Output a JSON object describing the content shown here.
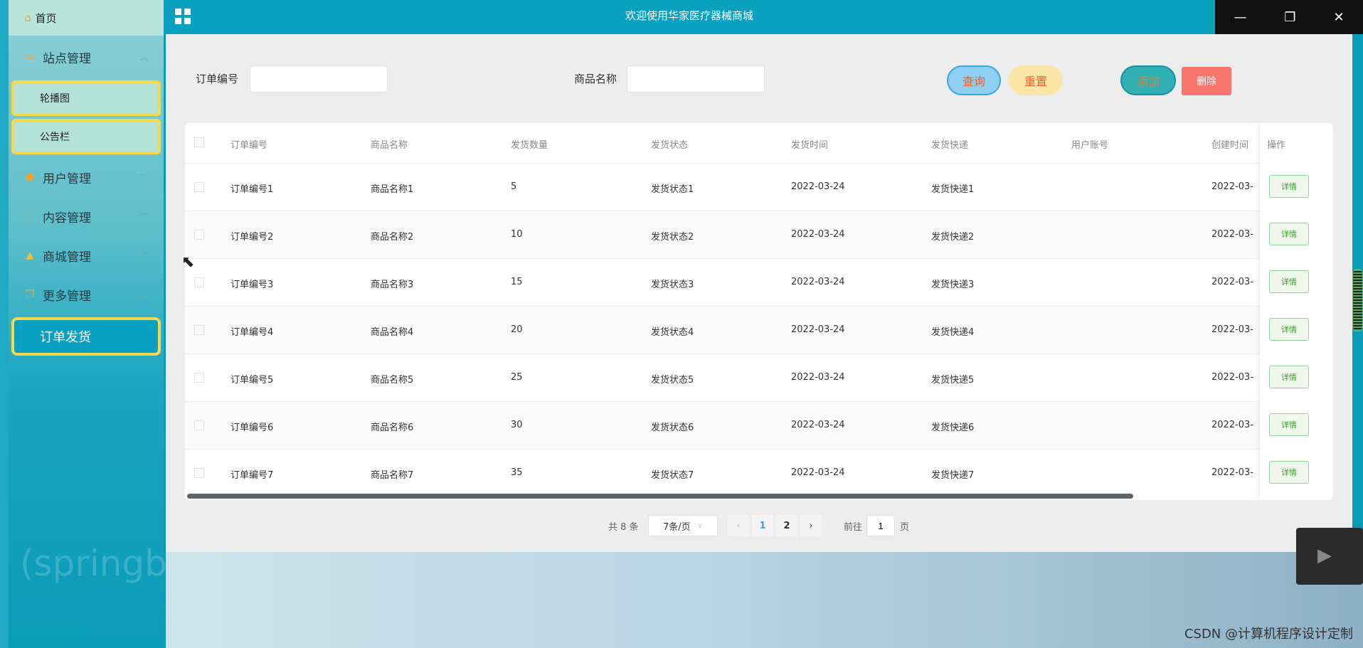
{
  "app": {
    "title": "欢迎使用华家医疗器械商城"
  },
  "window_controls": {
    "minimize": "—",
    "restore": "❐",
    "close": "✕"
  },
  "sidebar": {
    "home": "首页",
    "groups": [
      {
        "label": "站点管理",
        "icon": "monitor-icon",
        "expanded": true,
        "children": [
          "轮播图",
          "公告栏"
        ]
      },
      {
        "label": "用户管理",
        "icon": "user-icon",
        "expanded": false
      },
      {
        "label": "内容管理",
        "icon": "chat-icon",
        "expanded": false
      },
      {
        "label": "商城管理",
        "icon": "lock-icon",
        "expanded": false
      },
      {
        "label": "更多管理",
        "icon": "copy-icon",
        "expanded": true,
        "children": [
          "订单发货"
        ]
      }
    ],
    "overlay_text": "(springboot+mysql) 华家医疗器械商城 演示录像"
  },
  "search": {
    "order_no_label": "订单编号",
    "order_no_value": "",
    "product_name_label": "商品名称",
    "product_name_value": ""
  },
  "actions": {
    "query": "查询",
    "reset": "重置",
    "add": "添加",
    "delete": "删除"
  },
  "table": {
    "headers": [
      "订单编号",
      "商品名称",
      "发货数量",
      "发货状态",
      "发货时间",
      "发货快递",
      "用户账号",
      "创建时间",
      "操作"
    ],
    "rows": [
      [
        "订单编号1",
        "商品名称1",
        "5",
        "发货状态1",
        "2022-03-24",
        "发货快递1",
        "",
        "2022-03-"
      ],
      [
        "订单编号2",
        "商品名称2",
        "10",
        "发货状态2",
        "2022-03-24",
        "发货快递2",
        "",
        "2022-03-"
      ],
      [
        "订单编号3",
        "商品名称3",
        "15",
        "发货状态3",
        "2022-03-24",
        "发货快递3",
        "",
        "2022-03-"
      ],
      [
        "订单编号4",
        "商品名称4",
        "20",
        "发货状态4",
        "2022-03-24",
        "发货快递4",
        "",
        "2022-03-"
      ],
      [
        "订单编号5",
        "商品名称5",
        "25",
        "发货状态5",
        "2022-03-24",
        "发货快递5",
        "",
        "2022-03-"
      ],
      [
        "订单编号6",
        "商品名称6",
        "30",
        "发货状态6",
        "2022-03-24",
        "发货快递6",
        "",
        "2022-03-"
      ],
      [
        "订单编号7",
        "商品名称7",
        "35",
        "发货状态7",
        "2022-03-24",
        "发货快递7",
        "",
        "2022-03-"
      ]
    ],
    "detail_label": "详情"
  },
  "pagination": {
    "total": "共 8 条",
    "page_size": "7条/页",
    "pages": [
      "1",
      "2"
    ],
    "current_page": "1",
    "goto_label": "前往",
    "goto_value": "1",
    "page_suffix": "页"
  },
  "watermark": "CSDN @计算机程序设计定制",
  "colors": {
    "header": "#0aa0c0",
    "accent_border": "#f6d94a",
    "active_page": "#409eff",
    "detail_green": "#3c9a2f"
  }
}
